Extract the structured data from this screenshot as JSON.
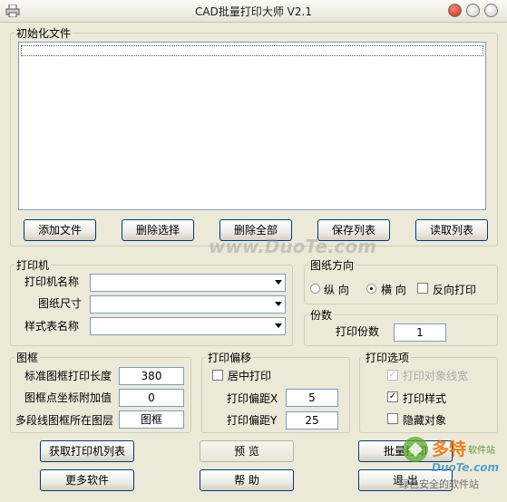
{
  "window": {
    "title": "CAD批量打印大师 V2.1"
  },
  "file_group": {
    "legend": "初始化文件"
  },
  "file_buttons": {
    "add": "添加文件",
    "delete_sel": "删除选择",
    "delete_all": "删除全部",
    "save_list": "保存列表",
    "read_list": "读取列表"
  },
  "printer_group": {
    "legend": "打印机",
    "printer_name": "打印机名称",
    "paper_size": "图纸尺寸",
    "style_table": "样式表名称"
  },
  "orientation_group": {
    "legend": "图纸方向",
    "portrait": "纵 向",
    "landscape": "横 向",
    "reverse": "反向打印",
    "selected": "landscape"
  },
  "copies_group": {
    "legend": "份数",
    "label": "打印份数",
    "value": "1"
  },
  "frame_group": {
    "legend": "图框",
    "std_len_label": "标准图框打印长度",
    "std_len_value": "380",
    "coord_add_label": "图框点坐标附加值",
    "coord_add_value": "0",
    "layer_label": "多段线图框所在图层",
    "layer_value": "图框"
  },
  "offset_group": {
    "legend": "打印偏移",
    "center_label": "居中打印",
    "center_checked": false,
    "x_label": "打印偏距X",
    "x_value": "5",
    "y_label": "打印偏距Y",
    "y_value": "25"
  },
  "options_group": {
    "legend": "打印选项",
    "opt1": "打印对象线宽",
    "opt1_checked": true,
    "opt1_enabled": false,
    "opt2": "打印样式",
    "opt2_checked": true,
    "opt3": "隐藏对象",
    "opt3_checked": false
  },
  "bottom_buttons": {
    "get_printers": "获取打印机列表",
    "preview": "预 览",
    "batch_print": "批量打印",
    "more": "更多软件",
    "help": "帮 助",
    "exit": "退 出"
  },
  "watermark": {
    "site": "www.DuoTe.com",
    "brand": "多特",
    "brand_sub": "软件站",
    "site2": "DuoTe.com",
    "tagline": "绿色安全的软件站"
  }
}
